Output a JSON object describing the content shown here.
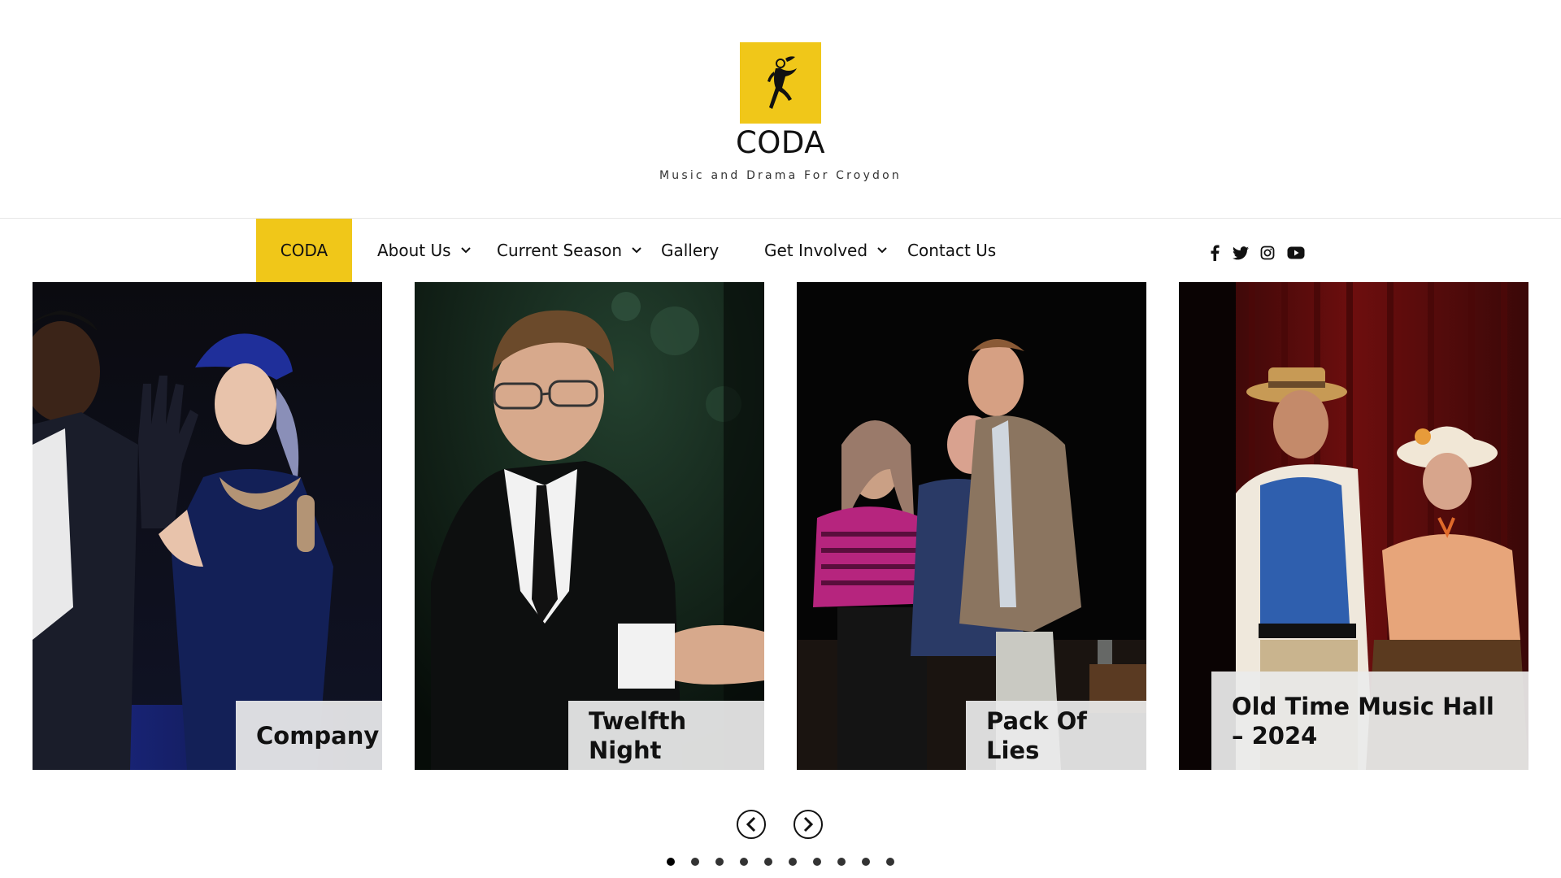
{
  "brand": {
    "title": "CODA",
    "tagline": "Music and Drama For Croydon",
    "accent": "#f0c719",
    "logo_icon": "dancer-logo-icon"
  },
  "nav": {
    "items": [
      {
        "label": "CODA",
        "active": true,
        "dropdown": false
      },
      {
        "label": "About Us",
        "active": false,
        "dropdown": true
      },
      {
        "label": "Current Season",
        "active": false,
        "dropdown": true
      },
      {
        "label": "Gallery",
        "active": false,
        "dropdown": false
      },
      {
        "label": "Get Involved",
        "active": false,
        "dropdown": true
      },
      {
        "label": "Contact Us",
        "active": false,
        "dropdown": false
      }
    ],
    "social": [
      "facebook-icon",
      "twitter-icon",
      "instagram-icon",
      "youtube-icon"
    ]
  },
  "slider": {
    "slides": [
      {
        "caption": "Company"
      },
      {
        "caption": "Twelfth Night"
      },
      {
        "caption": "Pack Of Lies"
      },
      {
        "caption": "Old Time Music Hall – 2024"
      }
    ],
    "dots": 10,
    "active_dot": 1
  }
}
